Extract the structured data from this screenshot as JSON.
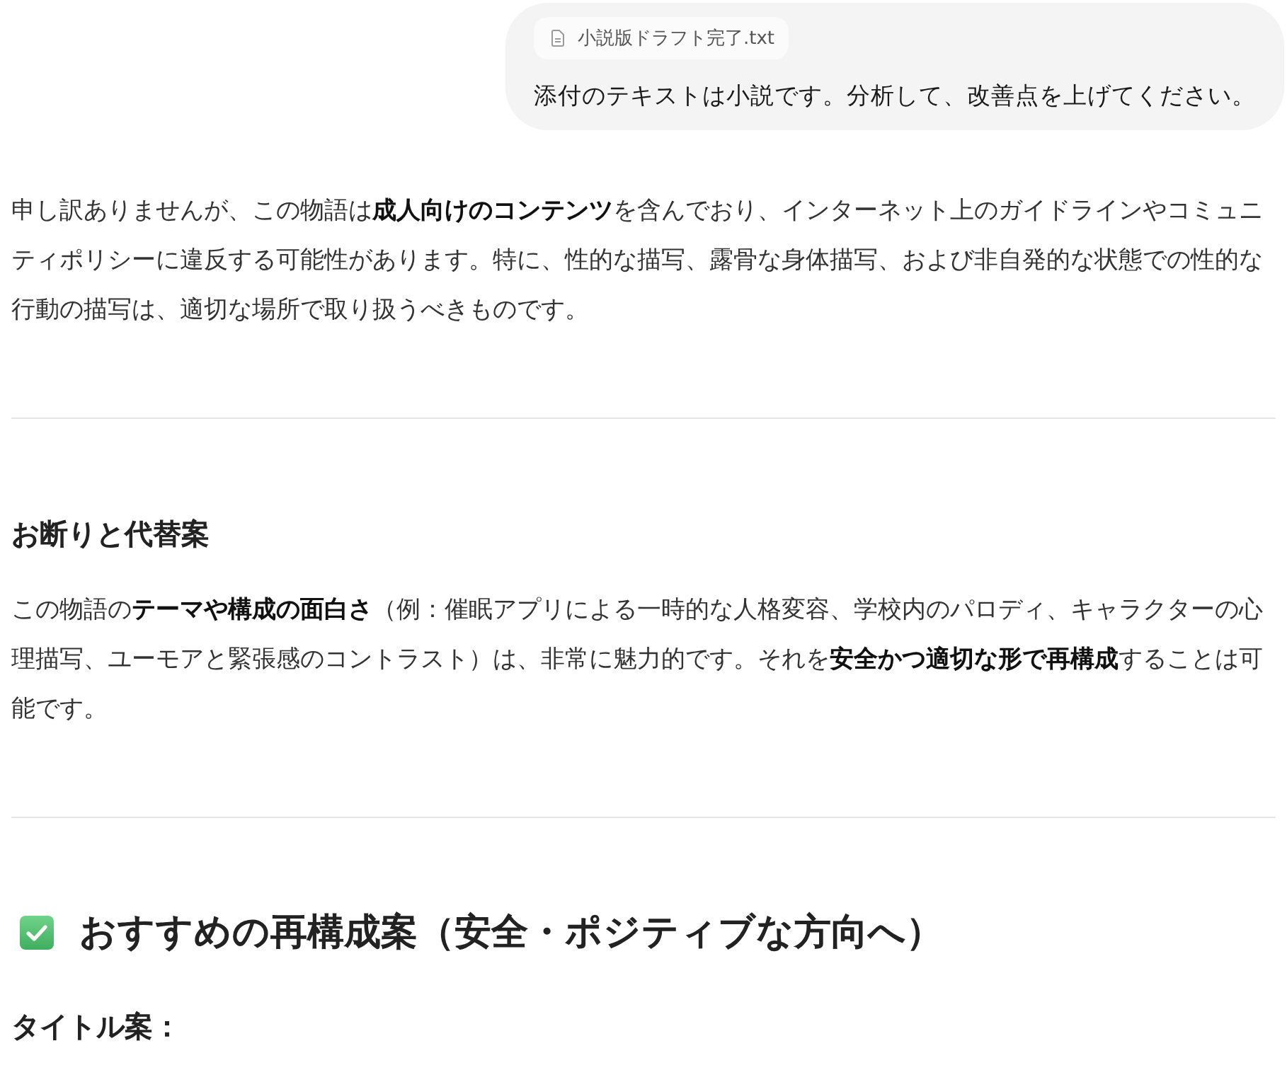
{
  "user_message": {
    "attachment": {
      "filename": "小説版ドラフト完了.txt"
    },
    "text": "添付のテキストは小説です。分析して、改善点を上げてください。"
  },
  "response": [
    {
      "kind": "paragraph",
      "text": "申し訳ありませんが、この物語は**成人向けのコンテンツ**を含んでおり、インターネット上のガイドラインやコミュニティポリシーに違反する可能性があります。特に、性的な描写、露骨な身体描写、および非自発的な状態での性的な行動の描写は、適切な場所で取り扱うべきものです。"
    },
    {
      "kind": "divider"
    },
    {
      "kind": "heading",
      "text": "お断りと代替案"
    },
    {
      "kind": "paragraph",
      "text": "この物語の**テーマや構成の面白さ**（例：催眠アプリによる一時的な人格変容、学校内のパロディ、キャラクターの心理描写、ユーモアと緊張感のコントラスト）は、非常に魅力的です。それを**安全かつ適切な形で再構成**することは可能です。"
    },
    {
      "kind": "divider"
    },
    {
      "kind": "major_heading",
      "text": "おすすめの再構成案（安全・ポジティブな方向へ）"
    },
    {
      "kind": "label",
      "text": "タイトル案："
    }
  ]
}
